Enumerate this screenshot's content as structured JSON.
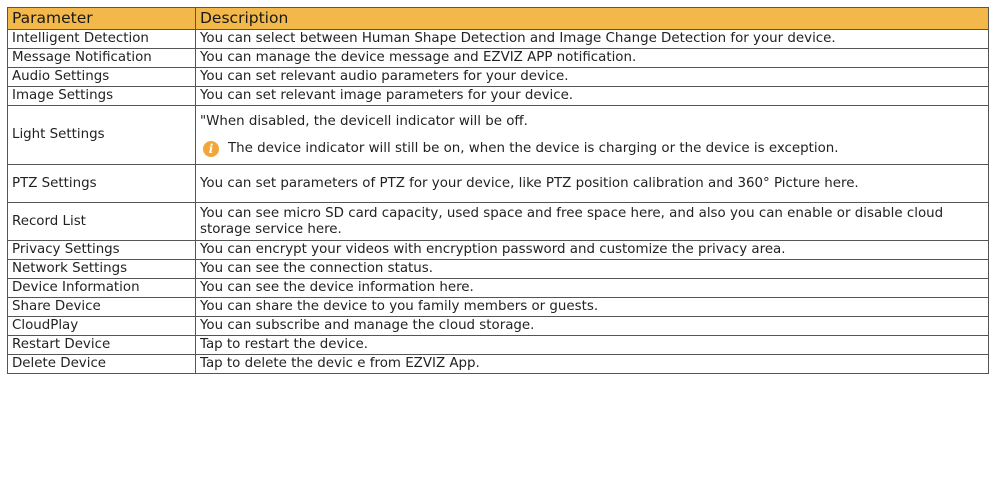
{
  "table": {
    "headers": {
      "parameter": "Parameter",
      "description": "Description"
    },
    "rows": [
      {
        "parameter": "Intelligent Detection",
        "description": "You can select between Human Shape Detection and Image Change Detection for your device."
      },
      {
        "parameter": "Message Notification",
        "description": "You can manage the device message and EZVIZ APP notification."
      },
      {
        "parameter": "Audio Settings",
        "description": "You can set relevant audio parameters for your device."
      },
      {
        "parameter": "Image Settings",
        "description": "You can set relevant image parameters for your device."
      },
      {
        "parameter": "Light Settings",
        "description": "\"When disabled, the devicell indicator will be off.",
        "note": "The device indicator will still be on, when the device is charging or the device is exception."
      },
      {
        "parameter": "PTZ Settings",
        "description": "You can set parameters of PTZ for your device, like PTZ position calibration and 360° Picture here."
      },
      {
        "parameter": "Record List",
        "description": "You can see micro SD card capacity, used space and free space here, and also you can enable or disable cloud storage service here."
      },
      {
        "parameter": "Privacy Settings",
        "description": "You can encrypt your videos with encryption password and customize the privacy area."
      },
      {
        "parameter": "Network Settings",
        "description": "You can see the connection status."
      },
      {
        "parameter": "Device Information",
        "description": "You can see the device information here."
      },
      {
        "parameter": "Share Device",
        "description": "You can share the device to you family members or guests."
      },
      {
        "parameter": "CloudPlay",
        "description": "You can subscribe and manage the cloud storage."
      },
      {
        "parameter": "Restart Device",
        "description": "Tap to restart the device."
      },
      {
        "parameter": "Delete Device",
        "description": "Tap to delete the devic e from EZVIZ App."
      }
    ]
  },
  "icons": {
    "note_icon": "info-icon",
    "note_icon_glyph": "i"
  },
  "colors": {
    "header_background": "#f2b84a",
    "info_icon": "#f2a63a",
    "border": "#555555"
  }
}
